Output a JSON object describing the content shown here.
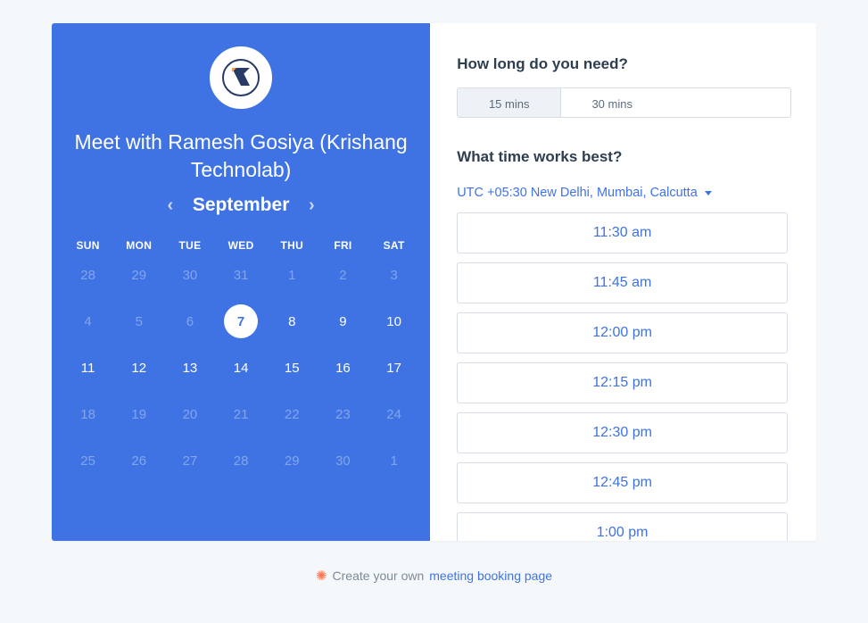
{
  "left": {
    "title": "Meet with Ramesh Gosiya (Krishang Technolab)",
    "month": "September",
    "dow": [
      "SUN",
      "MON",
      "TUE",
      "WED",
      "THU",
      "FRI",
      "SAT"
    ],
    "weeks": [
      [
        {
          "n": "28",
          "s": "dim"
        },
        {
          "n": "29",
          "s": "dim"
        },
        {
          "n": "30",
          "s": "dim"
        },
        {
          "n": "31",
          "s": "dim"
        },
        {
          "n": "1",
          "s": "dim"
        },
        {
          "n": "2",
          "s": "dim"
        },
        {
          "n": "3",
          "s": "dim"
        }
      ],
      [
        {
          "n": "4",
          "s": "dim"
        },
        {
          "n": "5",
          "s": "dim"
        },
        {
          "n": "6",
          "s": "dim"
        },
        {
          "n": "7",
          "s": "selected"
        },
        {
          "n": "8",
          "s": "avail"
        },
        {
          "n": "9",
          "s": "avail"
        },
        {
          "n": "10",
          "s": "avail"
        }
      ],
      [
        {
          "n": "11",
          "s": "avail"
        },
        {
          "n": "12",
          "s": "avail"
        },
        {
          "n": "13",
          "s": "avail"
        },
        {
          "n": "14",
          "s": "avail"
        },
        {
          "n": "15",
          "s": "avail"
        },
        {
          "n": "16",
          "s": "avail"
        },
        {
          "n": "17",
          "s": "avail"
        }
      ],
      [
        {
          "n": "18",
          "s": "dim"
        },
        {
          "n": "19",
          "s": "dim"
        },
        {
          "n": "20",
          "s": "dim"
        },
        {
          "n": "21",
          "s": "dim"
        },
        {
          "n": "22",
          "s": "dim"
        },
        {
          "n": "23",
          "s": "dim"
        },
        {
          "n": "24",
          "s": "dim"
        }
      ],
      [
        {
          "n": "25",
          "s": "dim"
        },
        {
          "n": "26",
          "s": "dim"
        },
        {
          "n": "27",
          "s": "dim"
        },
        {
          "n": "28",
          "s": "dim"
        },
        {
          "n": "29",
          "s": "dim"
        },
        {
          "n": "30",
          "s": "dim"
        },
        {
          "n": "1",
          "s": "dim"
        }
      ]
    ]
  },
  "right": {
    "duration_heading": "How long do you need?",
    "durations": [
      {
        "label": "15 mins",
        "selected": true
      },
      {
        "label": "30 mins",
        "selected": false
      }
    ],
    "time_heading": "What time works best?",
    "timezone": "UTC +05:30 New Delhi, Mumbai, Calcutta",
    "slots": [
      "11:30 am",
      "11:45 am",
      "12:00 pm",
      "12:15 pm",
      "12:30 pm",
      "12:45 pm",
      "1:00 pm"
    ]
  },
  "footer": {
    "text_prefix": "Create your own ",
    "link_text": "meeting booking page"
  }
}
